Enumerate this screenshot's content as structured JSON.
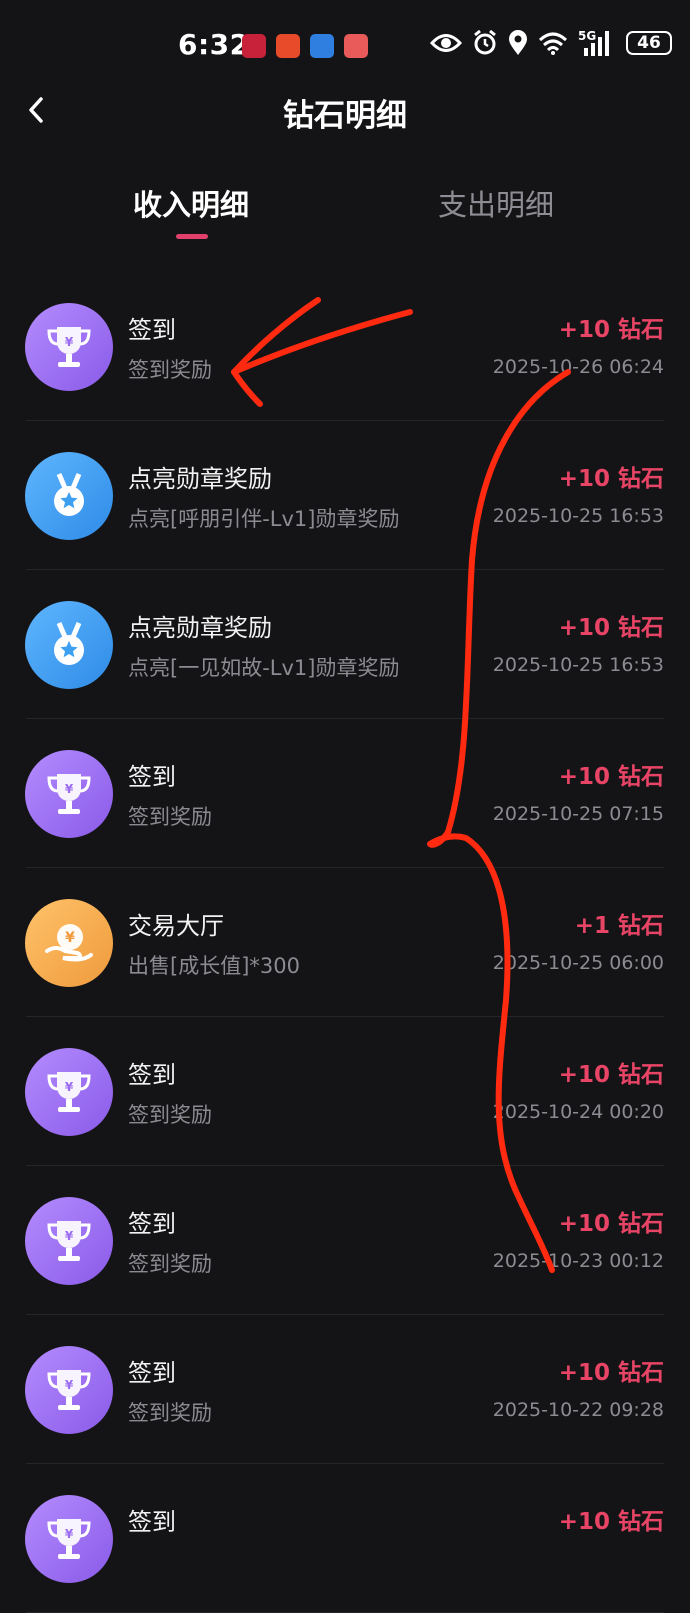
{
  "status_bar": {
    "time": "6:32",
    "network": "5G",
    "battery": "46",
    "app_icons": [
      "app-icon-1",
      "app-icon-2",
      "weather-app-icon",
      "app-icon-4"
    ],
    "status_icons": [
      "eye-icon",
      "alarm-icon",
      "location-icon",
      "wifi-icon",
      "signal-icon"
    ]
  },
  "header": {
    "title": "钻石明细",
    "back_icon": "chevron-left-icon"
  },
  "tabs": [
    {
      "label": "收入明细",
      "active": true
    },
    {
      "label": "支出明细",
      "active": false
    }
  ],
  "records": [
    {
      "icon": "trophy-icon",
      "title": "签到",
      "subtitle": "签到奖励",
      "amount": "+10 钻石",
      "date": "2025-10-26 06:24"
    },
    {
      "icon": "medal-icon",
      "title": "点亮勋章奖励",
      "subtitle": "点亮[呼朋引伴-Lv1]勋章奖励",
      "amount": "+10 钻石",
      "date": "2025-10-25 16:53"
    },
    {
      "icon": "medal-icon",
      "title": "点亮勋章奖励",
      "subtitle": "点亮[一见如故-Lv1]勋章奖励",
      "amount": "+10 钻石",
      "date": "2025-10-25 16:53"
    },
    {
      "icon": "trophy-icon",
      "title": "签到",
      "subtitle": "签到奖励",
      "amount": "+10 钻石",
      "date": "2025-10-25 07:15"
    },
    {
      "icon": "coin-hand-icon",
      "title": "交易大厅",
      "subtitle": "出售[成长值]*300",
      "amount": "+1 钻石",
      "date": "2025-10-25 06:00"
    },
    {
      "icon": "trophy-icon",
      "title": "签到",
      "subtitle": "签到奖励",
      "amount": "+10 钻石",
      "date": "2025-10-24 00:20"
    },
    {
      "icon": "trophy-icon",
      "title": "签到",
      "subtitle": "签到奖励",
      "amount": "+10 钻石",
      "date": "2025-10-23 00:12"
    },
    {
      "icon": "trophy-icon",
      "title": "签到",
      "subtitle": "签到奖励",
      "amount": "+10 钻石",
      "date": "2025-10-22 09:28"
    },
    {
      "icon": "trophy-icon",
      "title": "签到",
      "subtitle": "",
      "amount": "+10 钻石",
      "date": ""
    }
  ],
  "colors": {
    "background": "#141417",
    "accent": "#e84466",
    "trophy_bg": "#9b6cf0",
    "medal_bg": "#3d9ff0",
    "coin_bg": "#f2a347",
    "annotation": "#ff2a10"
  }
}
